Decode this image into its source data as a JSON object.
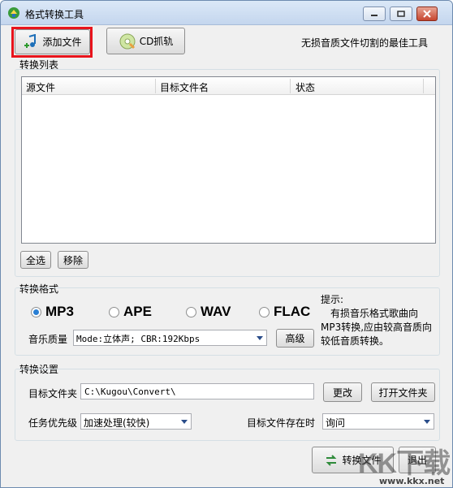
{
  "window": {
    "title": "格式转换工具"
  },
  "toolbar": {
    "add_file_label": "添加文件",
    "cd_rip_label": "CD抓轨",
    "tagline": "无损音质文件切割的最佳工具"
  },
  "list": {
    "group_label": "转换列表",
    "columns": [
      "源文件",
      "目标文件名",
      "状态"
    ],
    "select_all_label": "全选",
    "remove_label": "移除"
  },
  "format": {
    "group_label": "转换格式",
    "options": [
      "MP3",
      "APE",
      "WAV",
      "FLAC"
    ],
    "selected": "MP3",
    "quality_label": "音乐质量",
    "quality_value": "Mode:立体声; CBR:192Kbps",
    "advanced_label": "高级",
    "tip_title": "提示:",
    "tip_text": "有损音乐格式歌曲向MP3转换,应由较高音质向较低音质转换。"
  },
  "settings": {
    "group_label": "转换设置",
    "target_folder_label": "目标文件夹",
    "target_folder_value": "C:\\Kugou\\Convert\\",
    "change_label": "更改",
    "open_folder_label": "打开文件夹",
    "priority_label": "任务优先级",
    "priority_value": "加速处理(较快)",
    "exists_label": "目标文件存在时",
    "exists_value": "询问"
  },
  "footer": {
    "convert_label": "转换文件",
    "exit_label": "退出"
  },
  "watermark": {
    "text": "KK下载",
    "url": "www.kkx.net"
  },
  "colors": {
    "highlight": "#e8141c",
    "radio_on": "#2a7fd4"
  }
}
